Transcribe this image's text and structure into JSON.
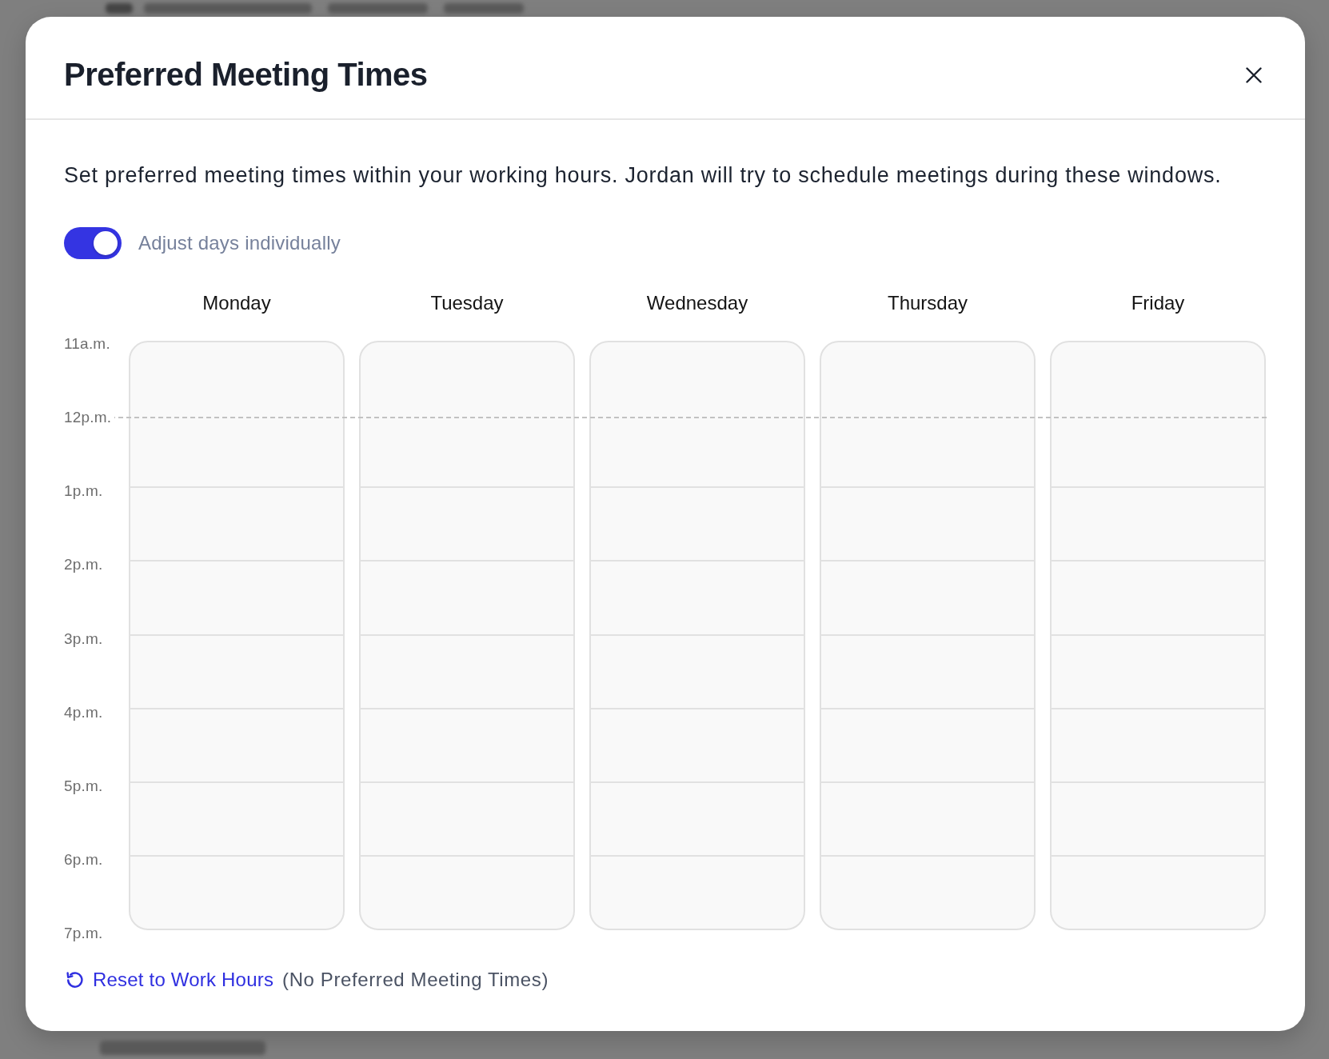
{
  "dialog": {
    "title": "Preferred Meeting Times",
    "description": "Set preferred meeting times within your working hours. Jordan will try to schedule meetings during these windows.",
    "toggle": {
      "label": "Adjust days individually",
      "on": true
    },
    "days": [
      "Monday",
      "Tuesday",
      "Wednesday",
      "Thursday",
      "Friday"
    ],
    "time_labels": [
      {
        "label": "11a.m.",
        "kind": "edge"
      },
      {
        "label": "12p.m.",
        "kind": "dashed"
      },
      {
        "label": "1p.m.",
        "kind": "solid"
      },
      {
        "label": "2p.m.",
        "kind": "solid"
      },
      {
        "label": "3p.m.",
        "kind": "solid"
      },
      {
        "label": "4p.m.",
        "kind": "solid"
      },
      {
        "label": "5p.m.",
        "kind": "solid"
      },
      {
        "label": "6p.m.",
        "kind": "solid"
      },
      {
        "label": "7p.m.",
        "kind": "edge"
      }
    ],
    "reset_link": "Reset to Work Hours",
    "reset_note": "(No Preferred Meeting Times)"
  }
}
